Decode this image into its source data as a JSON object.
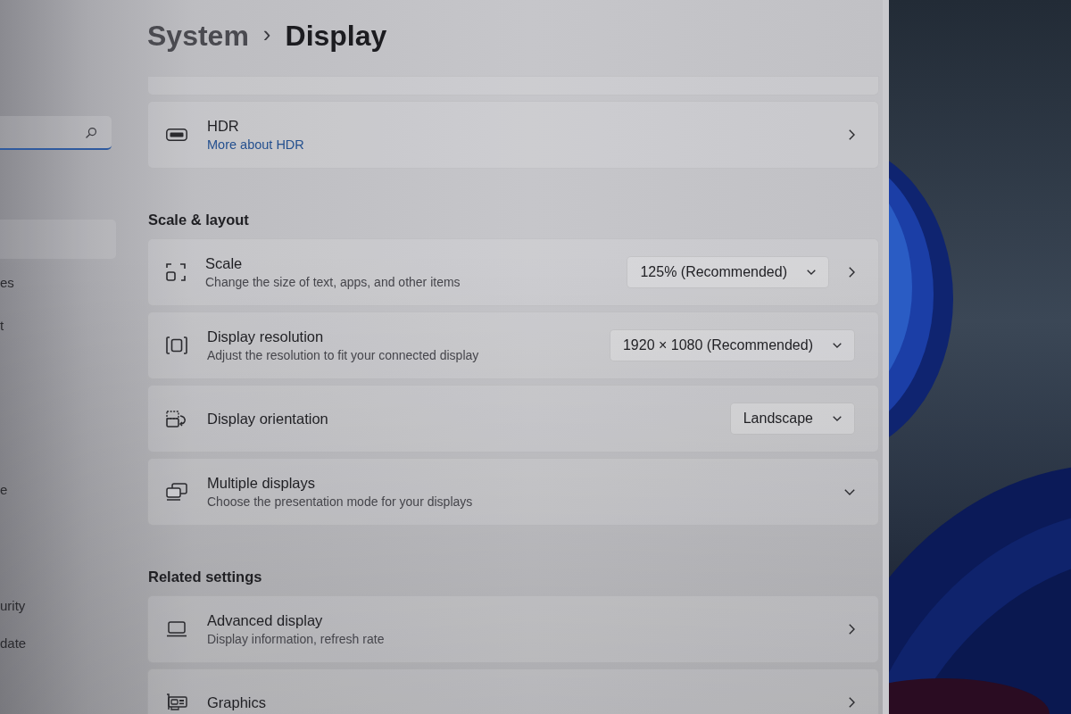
{
  "sidebar": {
    "search": {
      "focused": true
    },
    "items": [
      {
        "selected": true
      },
      {
        "label": "es",
        "selected": false
      },
      {
        "label": "t",
        "selected": false
      },
      {
        "label": "e",
        "selected": false
      },
      {
        "label": "urity",
        "selected": false
      },
      {
        "label": "date",
        "selected": false
      }
    ]
  },
  "header": {
    "breadcrumb": "System",
    "separator": "›",
    "title": "Display"
  },
  "content": [
    {
      "kind": "cut_card"
    },
    {
      "kind": "card",
      "title": "HDR",
      "link": "More about HDR",
      "navigable": true
    },
    {
      "kind": "heading",
      "text": "Scale & layout"
    },
    {
      "kind": "card",
      "title": "Scale",
      "subtitle": "Change the size of text, apps, and other items",
      "dropdown": "125% (Recommended)",
      "navigable": true
    },
    {
      "kind": "card",
      "title": "Display resolution",
      "subtitle": "Adjust the resolution to fit your connected display",
      "dropdown": "1920 × 1080 (Recommended)",
      "navigable": false
    },
    {
      "kind": "card",
      "title": "Display orientation",
      "dropdown": "Landscape",
      "navigable": false
    },
    {
      "kind": "card",
      "title": "Multiple displays",
      "subtitle": "Choose the presentation mode for your displays",
      "navigable": false,
      "expanded": false
    },
    {
      "kind": "heading",
      "text": "Related settings"
    },
    {
      "kind": "card",
      "title": "Advanced display",
      "subtitle": "Display information, refresh rate",
      "navigable": true
    },
    {
      "kind": "card",
      "title": "Graphics",
      "navigable": true
    }
  ]
}
